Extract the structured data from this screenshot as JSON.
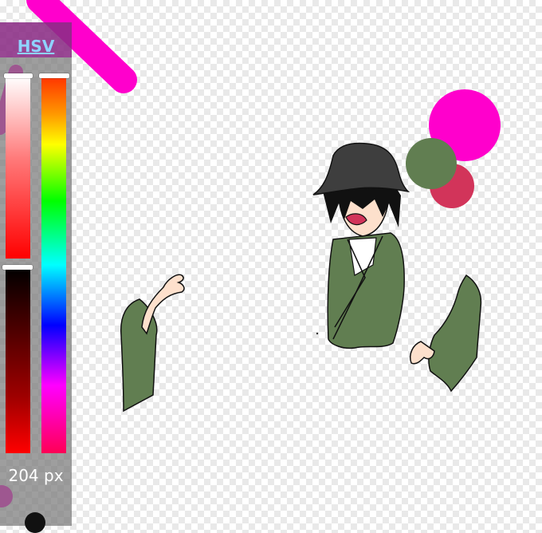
{
  "panel": {
    "mode_label": "HSV",
    "brush_size": "204 px"
  },
  "colors": {
    "selected": "#ff00cc",
    "green": "#617e51",
    "crimson": "#d2345a"
  },
  "icons": {
    "brush_size_indicator": "filled-circle"
  }
}
